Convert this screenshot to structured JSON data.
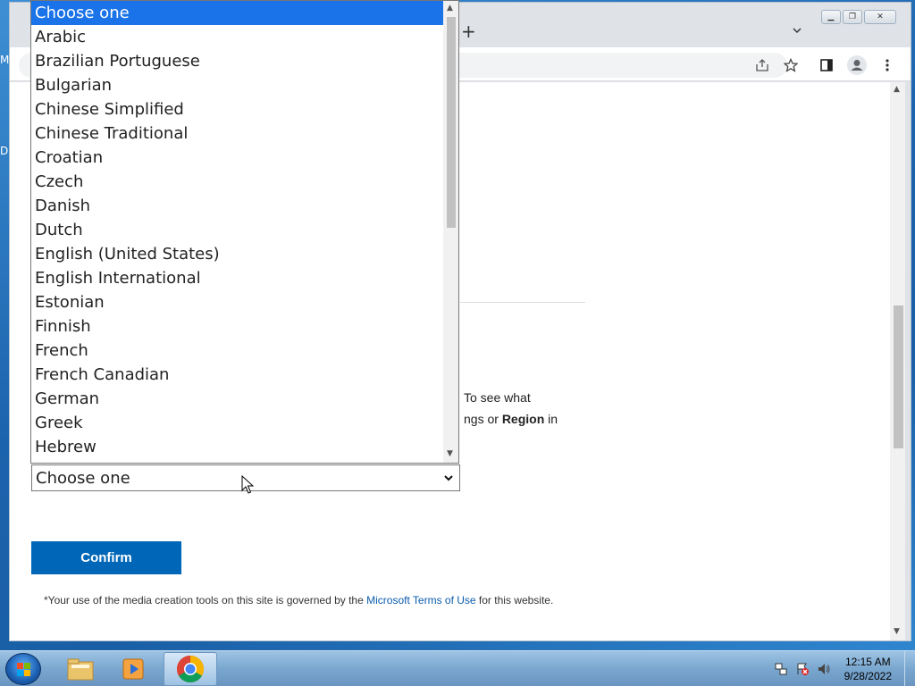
{
  "desktop": {
    "labels": [
      "M",
      "D"
    ]
  },
  "browser": {
    "new_tab_label": "+",
    "page": {
      "paragraph_line1": "To see what",
      "paragraph_line2_prefix": "ngs or ",
      "paragraph_line2_bold": "Region",
      "paragraph_line2_suffix": " in",
      "language_select_value": "Choose one",
      "confirm_label": "Confirm",
      "terms_prefix": "*Your use of the media creation tools on this site is governed by the ",
      "terms_link": "Microsoft Terms of Use",
      "terms_suffix": " for this website."
    }
  },
  "dropdown": {
    "options": [
      "Choose one",
      "Arabic",
      "Brazilian Portuguese",
      "Bulgarian",
      "Chinese Simplified",
      "Chinese Traditional",
      "Croatian",
      "Czech",
      "Danish",
      "Dutch",
      "English (United States)",
      "English International",
      "Estonian",
      "Finnish",
      "French",
      "French Canadian",
      "German",
      "Greek",
      "Hebrew"
    ],
    "selected_index": 0,
    "selected_color": "#1a73e8"
  },
  "taskbar": {
    "time": "12:15 AM",
    "date": "9/28/2022"
  },
  "colors": {
    "confirm_bg": "#0067b8",
    "link": "#0b5cad"
  }
}
